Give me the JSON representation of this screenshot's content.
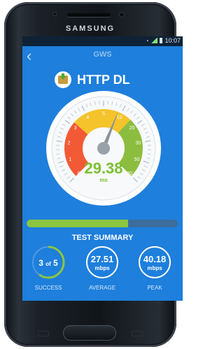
{
  "device": {
    "brand": "SAMSUNG"
  },
  "status_bar": {
    "time": "10:07"
  },
  "app": {
    "title": "GWS",
    "test_name": "HTTP DL"
  },
  "gauge": {
    "value": "29.38",
    "unit": "ms",
    "ticks": [
      "0",
      "1",
      "2",
      "3",
      "4",
      "5",
      "10",
      "20",
      "30",
      "50",
      "100"
    ],
    "needle_value": 5.8,
    "colors": {
      "red": "#f25a35",
      "yellow": "#f5c32b",
      "green": "#8cbd3f",
      "track": "#c9d3dc"
    }
  },
  "progress": {
    "fraction": 0.67
  },
  "summary": {
    "title": "TEST SUMMARY",
    "success": {
      "done": "3",
      "of_label": "of",
      "total": "5",
      "caption": "SUCCESS"
    },
    "average": {
      "value": "27.51",
      "unit": "mbps",
      "caption": "AVERAGE"
    },
    "peak": {
      "value": "40.18",
      "unit": "mbps",
      "caption": "PEAK"
    }
  },
  "colors": {
    "screen_bg": "#1e7fdc",
    "accent_green": "#8bc53f"
  }
}
